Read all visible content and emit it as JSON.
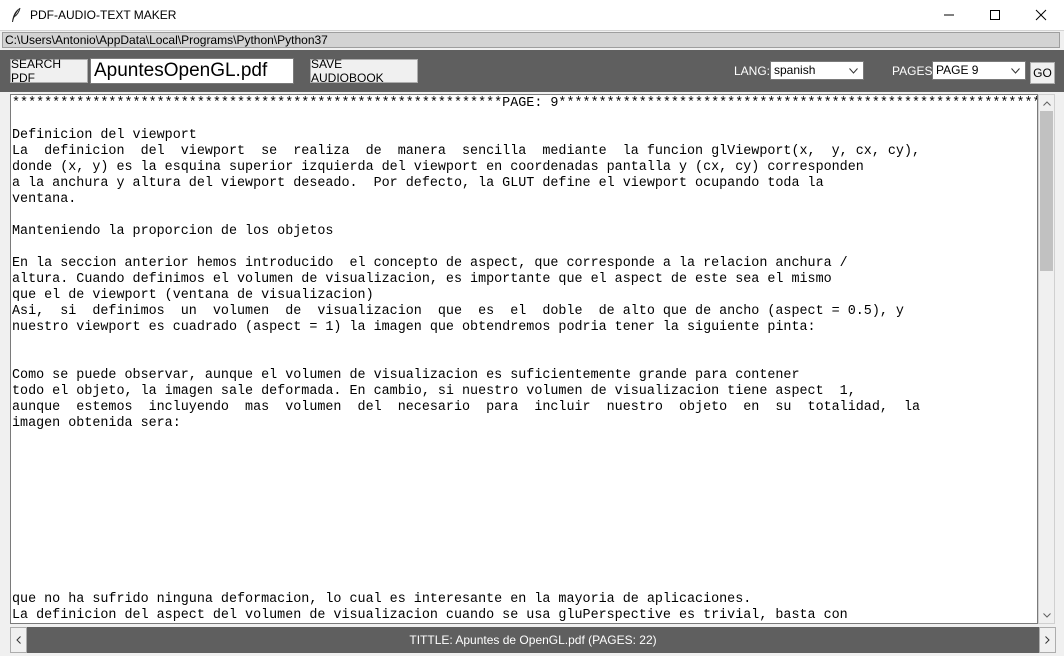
{
  "window": {
    "title": "PDF-AUDIO-TEXT MAKER",
    "path": "C:\\Users\\Antonio\\AppData\\Local\\Programs\\Python\\Python37"
  },
  "toolbar": {
    "search_label": "SEARCH PDF",
    "file_value": "ApuntesOpenGL.pdf",
    "save_label": "SAVE AUDIOBOOK",
    "lang_label": "LANG:",
    "lang_value": "spanish",
    "pages_label": "PAGES:",
    "pages_value": "PAGE 9",
    "go_label": "GO"
  },
  "content": {
    "text": "*************************************************************PAGE: 9***************************************************************\n\nDefinicion del viewport\nLa  definicion  del  viewport  se  realiza  de  manera  sencilla  mediante  la funcion glViewport(x,  y, cx, cy),\ndonde (x, y) es la esquina superior izquierda del viewport en coordenadas pantalla y (cx, cy) corresponden\na la anchura y altura del viewport deseado.  Por defecto, la GLUT define el viewport ocupando toda la\nventana.\n\nManteniendo la proporcion de los objetos\n\nEn la seccion anterior hemos introducido  el concepto de aspect, que corresponde a la relacion anchura /\naltura. Cuando definimos el volumen de visualizacion, es importante que el aspect de este sea el mismo\nque el de viewport (ventana de visualizacion)\nAsi,  si  definimos  un  volumen  de  visualizacion  que  es  el  doble  de alto que de ancho (aspect = 0.5), y\nnuestro viewport es cuadrado (aspect = 1) la imagen que obtendremos podria tener la siguiente pinta:\n\n\nComo se puede observar, aunque el volumen de visualizacion es suficientemente grande para contener\ntodo el objeto, la imagen sale deformada. En cambio, si nuestro volumen de visualizacion tiene aspect  1,\naunque  estemos  incluyendo  mas  volumen  del  necesario  para  incluir  nuestro  objeto  en  su  totalidad,  la\nimagen obtenida sera:\n\n\n\n\n\n\n\n\n\n\nque no ha sufrido ninguna deformacion, lo cual es interesante en la mayoria de aplicaciones.\nLa definicion del aspect del volumen de visualizacion cuando se usa gluPerspective es trivial, basta con\npasarle el parametro adecuado. Para el caso de las funciones glFrustum y glOrtho hay que definir los\nvalores left, right, top y bottom teniendo en cuenta que a relacion que tienen que mantener entre ellos"
  },
  "status": {
    "text": "TITTLE: Apuntes de OpenGL.pdf (PAGES: 22)"
  },
  "icons": {
    "app": "feather-icon",
    "minimize": "minimize-icon",
    "maximize": "maximize-icon",
    "close": "close-icon",
    "dropdown": "chevron-down-icon",
    "scroll_up": "scroll-up-arrow-icon",
    "scroll_down": "scroll-down-arrow-icon",
    "scroll_left": "scroll-left-arrow-icon",
    "scroll_right": "scroll-right-arrow-icon"
  },
  "colors": {
    "toolbar_bg": "#5f5f5f",
    "window_bg": "#f0f0f0",
    "path_bg": "#d3d3d3"
  }
}
